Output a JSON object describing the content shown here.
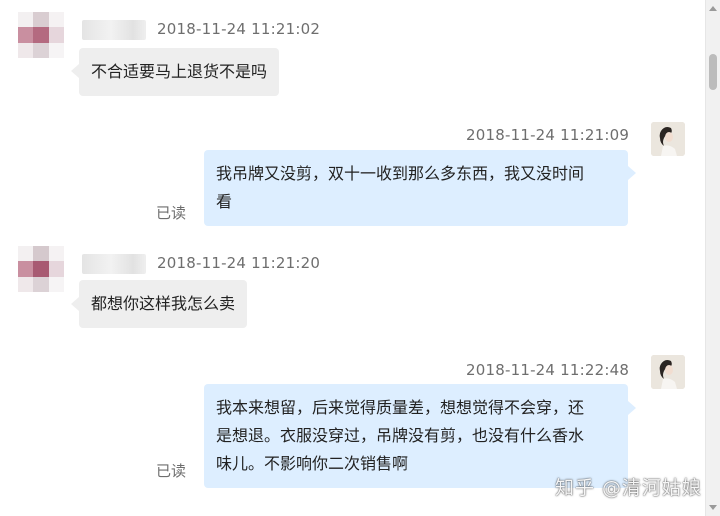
{
  "messages": [
    {
      "direction": "incoming",
      "timestamp": "2018-11-24 11:21:02",
      "text": "不合适要马上退货不是吗"
    },
    {
      "direction": "outgoing",
      "timestamp": "2018-11-24 11:21:09",
      "lines": [
        "我吊牌又没剪，双十一收到那么多东西，我又没时间",
        "看"
      ],
      "status": "已读"
    },
    {
      "direction": "incoming",
      "timestamp": "2018-11-24 11:21:20",
      "text": "都想你这样我怎么卖"
    },
    {
      "direction": "outgoing",
      "timestamp": "2018-11-24 11:22:48",
      "lines": [
        "我本来想留，后来觉得质量差，想想觉得不会穿，还",
        "是想退。衣服没穿过，吊牌没有剪，也没有什么香水",
        "味儿。不影响你二次销售啊"
      ],
      "status": "已读"
    }
  ],
  "watermark": "知乎 @清河姑娘",
  "colors": {
    "incoming_bubble": "#eeeeee",
    "outgoing_bubble": "#ddeeff",
    "timestamp": "#6e6e6e",
    "background": "#ffffff"
  },
  "icons": {
    "contact_avatar": "pixelated-avatar-icon",
    "own_avatar": "user-avatar-icon"
  }
}
